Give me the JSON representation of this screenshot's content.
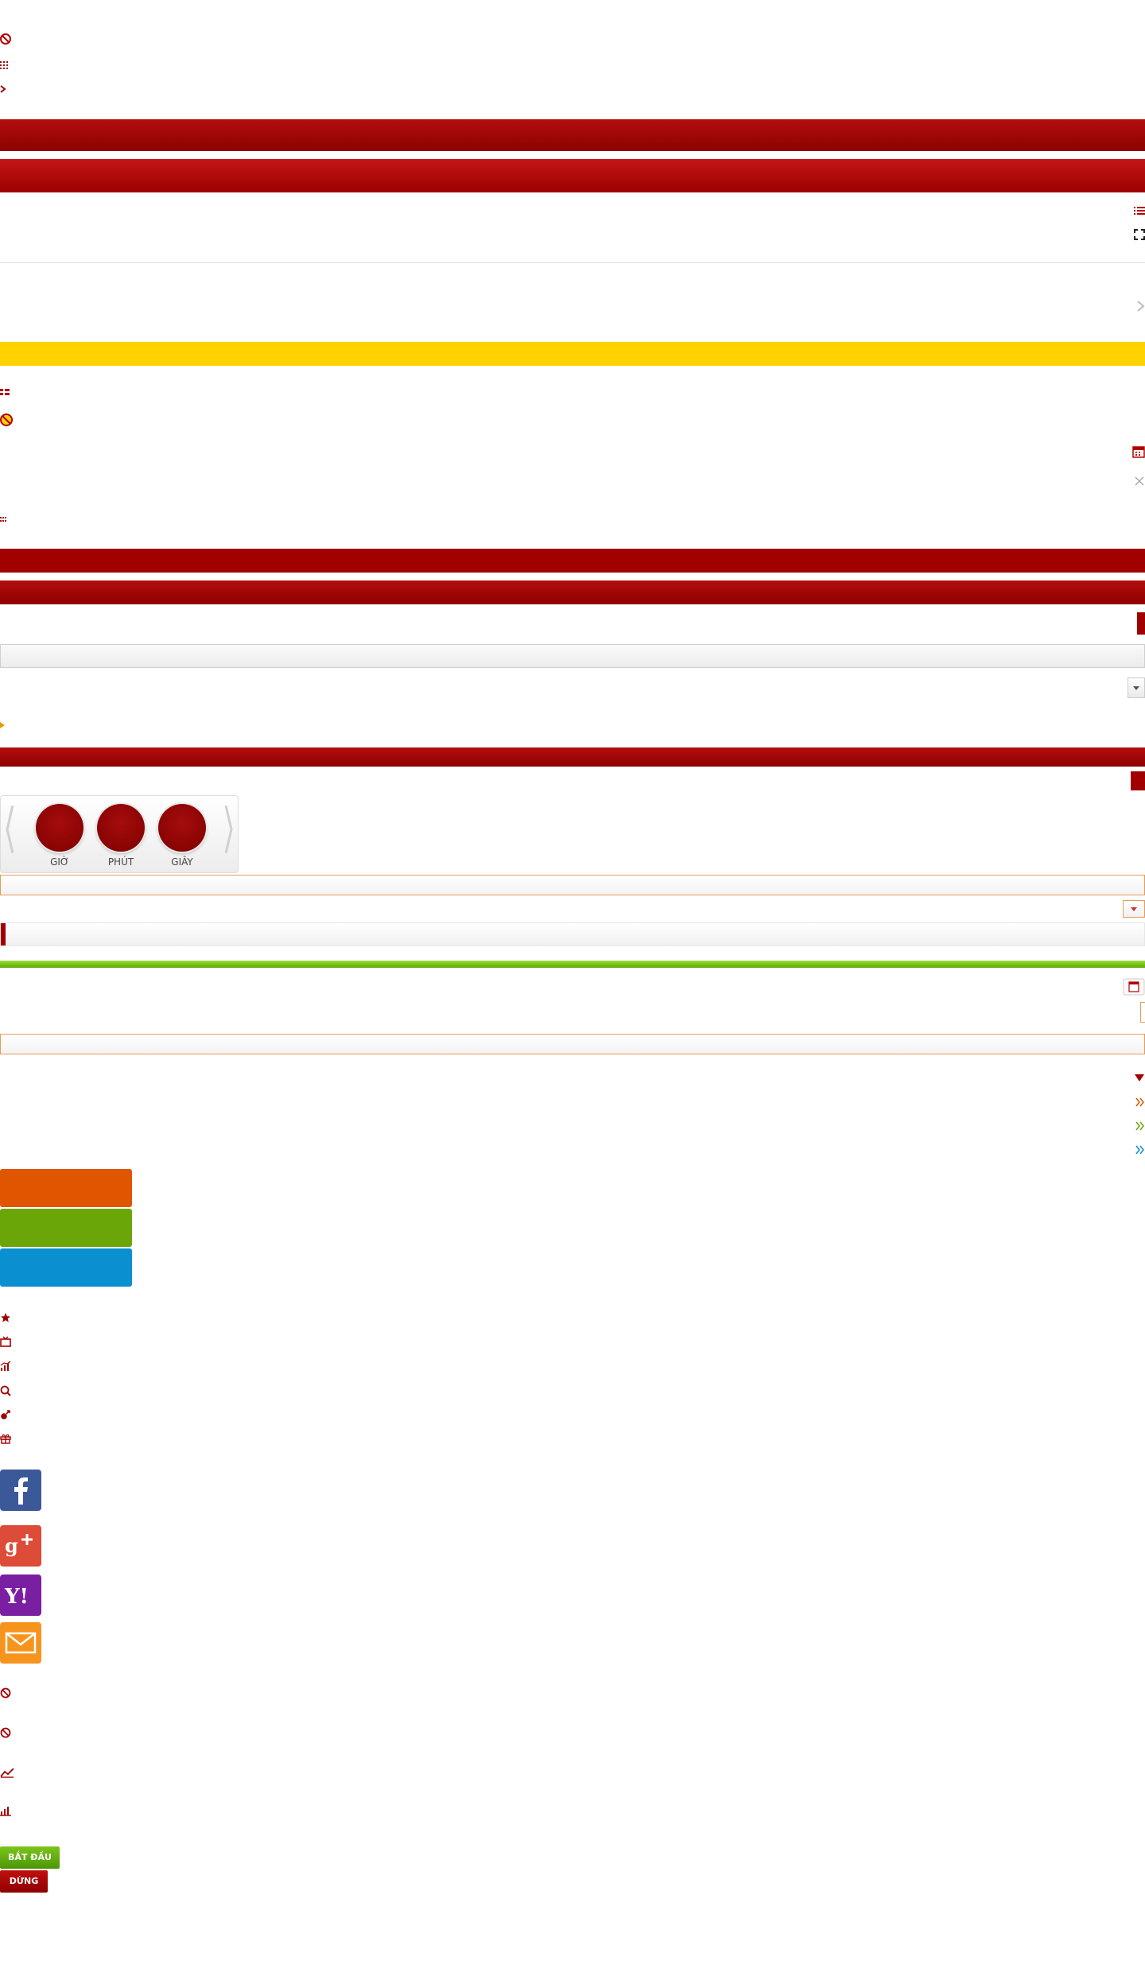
{
  "countdown": {
    "hours_label": "GIỜ",
    "minutes_label": "PHÚT",
    "seconds_label": "GIÂY"
  },
  "buttons": {
    "start_label": "BẮT ĐẦU",
    "stop_label": "DỪNG"
  },
  "colors": {
    "dark_red": "#a10000",
    "yellow": "#ffd200",
    "green": "#6aa607",
    "orange": "#e05500",
    "blue": "#0a8fd1",
    "facebook": "#3b5998",
    "google_plus": "#dd4b39",
    "yahoo": "#7b1fa2",
    "mail": "#f7941d"
  },
  "icons": [
    "lottery-ball-icon",
    "grid-icon",
    "arrow-icon",
    "list-icon",
    "expand-icon",
    "chevron-right-icon",
    "flag-icon",
    "calendar-icon",
    "close-icon",
    "dropdown-arrow-icon",
    "star-icon",
    "tv-icon",
    "chart-icon",
    "search-icon",
    "gender-icon",
    "gift-icon",
    "facebook-icon",
    "google-plus-icon",
    "yahoo-icon",
    "mail-icon",
    "line-chart-icon",
    "bar-chart-icon"
  ]
}
